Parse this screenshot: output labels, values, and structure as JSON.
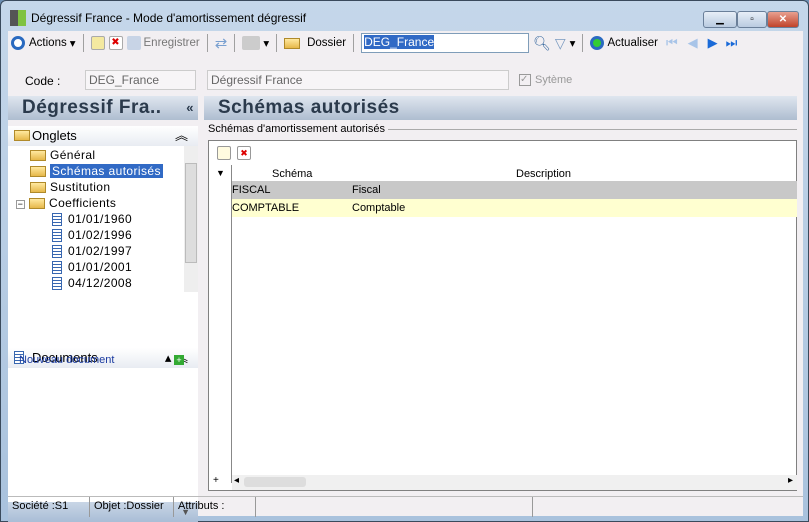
{
  "window": {
    "title": "Dégressif France -  Mode d'amortissement dégressif",
    "buttons": [
      "minimize",
      "maximize",
      "close"
    ]
  },
  "toolbar": {
    "actions": "Actions",
    "save": "Enregistrer",
    "folder": "Dossier",
    "search_value": "DEG_France",
    "refresh": "Actualiser"
  },
  "form": {
    "code_label": "Code :",
    "code_value": "DEG_France",
    "name_value": "Dégressif France",
    "system_label": "Sytème",
    "system_checked": true
  },
  "left": {
    "header": "Dégressif Fra..",
    "tabs_title": "Onglets",
    "tree": [
      "Général",
      "Schémas autorisés",
      "Sustitution",
      "Coefficients"
    ],
    "dates": [
      "01/01/1960",
      "01/02/1996",
      "01/02/1997",
      "01/01/2001",
      "04/12/2008"
    ],
    "selected": "Schémas autorisés",
    "documents_title": "Documents",
    "new_document": "Nouveau document"
  },
  "main": {
    "header": "Schémas autorisés",
    "group_label": "Schémas d'amortissement autorisés",
    "columns": [
      "Schéma",
      "Description"
    ],
    "rows": [
      {
        "schema": "FISCAL",
        "description": "Fiscal"
      },
      {
        "schema": "COMPTABLE",
        "description": "Comptable"
      }
    ]
  },
  "status": {
    "societe": "Société :S1",
    "objet": "Objet :Dossier",
    "attributs": "Attributs :"
  }
}
